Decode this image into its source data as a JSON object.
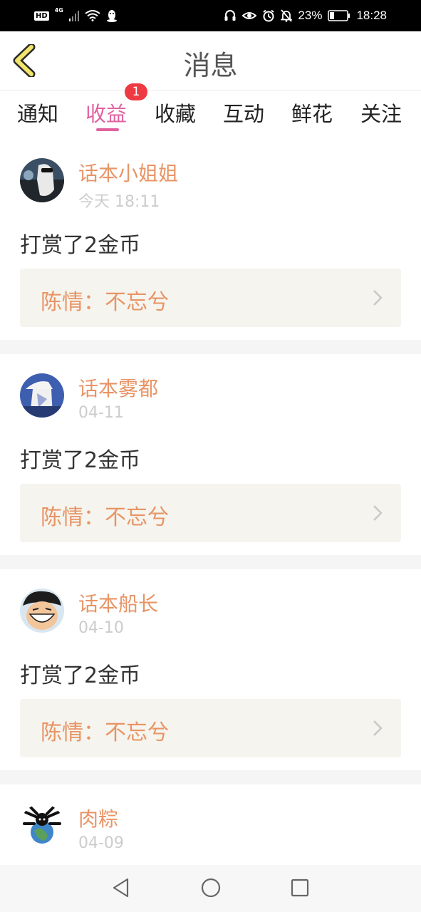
{
  "status_bar": {
    "hd": "HD",
    "network": "4G",
    "battery": "23%",
    "time": "18:28"
  },
  "header": {
    "title": "消息",
    "back_icon": "chevron-left-icon"
  },
  "tabs": [
    {
      "label": "通知",
      "active": false
    },
    {
      "label": "收益",
      "active": true,
      "badge": "1"
    },
    {
      "label": "收藏",
      "active": false
    },
    {
      "label": "互动",
      "active": false
    },
    {
      "label": "鲜花",
      "active": false
    },
    {
      "label": "关注",
      "active": false
    }
  ],
  "messages": [
    {
      "user": "话本小姐姐",
      "time": "今天 18:11",
      "text": "打赏了2金币",
      "work": "陈情：不忘兮"
    },
    {
      "user": "话本雾都",
      "time": "04-11",
      "text": "打赏了2金币",
      "work": "陈情：不忘兮"
    },
    {
      "user": "话本船长",
      "time": "04-10",
      "text": "打赏了2金币",
      "work": "陈情：不忘兮"
    },
    {
      "user": "肉粽",
      "time": "04-09"
    }
  ],
  "nav": [
    "back-triangle-icon",
    "home-circle-icon",
    "recents-square-icon"
  ],
  "colors": {
    "accent_pink": "#e2609f",
    "username_orange": "#e89465",
    "badge_red": "#ee3a43",
    "link_bg": "#f5f4ee",
    "back_arrow_yellow": "#f2e56b"
  }
}
